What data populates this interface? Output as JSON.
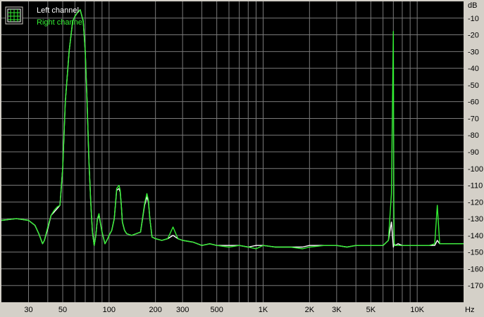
{
  "colors": {
    "frame": "#d4d0c8",
    "plot_bg": "#000000",
    "grid": "#7a7a7a",
    "left_channel": "#ffffff",
    "right_channel": "#33ee33"
  },
  "legend": {
    "icon": "grid-window-icon",
    "placement": "top-left",
    "items": [
      {
        "label": "Left channel",
        "color": "#ffffff"
      },
      {
        "label": "Right channel",
        "color": "#33ee33"
      }
    ]
  },
  "chart_data": {
    "type": "line",
    "title": "",
    "xlabel": "Hz",
    "ylabel": "dB",
    "xscale": "log",
    "xlim": [
      20,
      20000
    ],
    "ylim": [
      -180,
      0
    ],
    "grid": true,
    "yticks": [
      -10,
      -20,
      -30,
      -40,
      -50,
      -60,
      -70,
      -80,
      -90,
      -100,
      -110,
      -120,
      -130,
      -140,
      -150,
      -160,
      -170
    ],
    "xticks": [
      {
        "value": 30,
        "label": "30"
      },
      {
        "value": 50,
        "label": "50"
      },
      {
        "value": 100,
        "label": "100"
      },
      {
        "value": 200,
        "label": "200"
      },
      {
        "value": 300,
        "label": "300"
      },
      {
        "value": 500,
        "label": "500"
      },
      {
        "value": 1000,
        "label": "1K"
      },
      {
        "value": 2000,
        "label": "2K"
      },
      {
        "value": 3000,
        "label": "3K"
      },
      {
        "value": 5000,
        "label": "5K"
      },
      {
        "value": 10000,
        "label": "10K"
      }
    ],
    "series": [
      {
        "name": "Left channel",
        "color": "#ffffff",
        "x": [
          20,
          25,
          30,
          33,
          35,
          37,
          38,
          40,
          42,
          44,
          46,
          48,
          50,
          52,
          55,
          58,
          60,
          62,
          65,
          68,
          70,
          72,
          74,
          76,
          78,
          80,
          82,
          84,
          86,
          88,
          90,
          94,
          98,
          100,
          104,
          108,
          112,
          116,
          118,
          120,
          122,
          126,
          130,
          140,
          150,
          160,
          170,
          176,
          180,
          184,
          190,
          200,
          220,
          240,
          260,
          280,
          300,
          350,
          400,
          450,
          500,
          600,
          700,
          800,
          900,
          1000,
          1200,
          1500,
          1800,
          2000,
          2500,
          3000,
          3500,
          4000,
          5000,
          6000,
          6500,
          6800,
          7000,
          7050,
          7100,
          7200,
          7500,
          8000,
          9000,
          10000,
          12000,
          13000,
          13500,
          14000,
          14500,
          15000,
          17000,
          20000
        ],
        "values": [
          -131,
          -130,
          -131,
          -134,
          -139,
          -145,
          -143,
          -136,
          -128,
          -126,
          -124,
          -122,
          -100,
          -60,
          -30,
          -12,
          -9,
          -7,
          -5,
          -12,
          -30,
          -60,
          -95,
          -120,
          -138,
          -146,
          -140,
          -130,
          -128,
          -133,
          -138,
          -145,
          -142,
          -140,
          -137,
          -130,
          -113,
          -112,
          -114,
          -122,
          -132,
          -137,
          -139,
          -140,
          -139,
          -138,
          -122,
          -117,
          -120,
          -130,
          -141,
          -142,
          -143,
          -142,
          -140,
          -142,
          -143,
          -144,
          -146,
          -145,
          -146,
          -146,
          -146,
          -147,
          -146,
          -146,
          -147,
          -147,
          -147,
          -146,
          -146,
          -146,
          -147,
          -146,
          -146,
          -146,
          -143,
          -132,
          -147,
          -146,
          -145,
          -146,
          -145,
          -146,
          -146,
          -146,
          -146,
          -146,
          -143,
          -145,
          -145,
          -145,
          -145,
          -145
        ]
      },
      {
        "name": "Right channel",
        "color": "#33ee33",
        "x": [
          20,
          25,
          30,
          33,
          35,
          37,
          38,
          40,
          42,
          44,
          46,
          48,
          50,
          52,
          55,
          58,
          60,
          62,
          65,
          68,
          70,
          72,
          74,
          76,
          78,
          80,
          82,
          84,
          86,
          88,
          90,
          94,
          98,
          100,
          104,
          108,
          112,
          116,
          118,
          120,
          122,
          126,
          130,
          140,
          150,
          160,
          170,
          176,
          180,
          184,
          190,
          200,
          220,
          240,
          260,
          280,
          300,
          350,
          400,
          450,
          500,
          600,
          700,
          800,
          900,
          1000,
          1200,
          1500,
          1800,
          2000,
          2500,
          3000,
          3500,
          4000,
          5000,
          6000,
          6500,
          6800,
          7000,
          7050,
          7100,
          7200,
          7500,
          8000,
          9000,
          10000,
          12000,
          13000,
          13500,
          14000,
          14500,
          15000,
          17000,
          20000
        ],
        "values": [
          -131,
          -130,
          -131,
          -134,
          -139,
          -145,
          -143,
          -135,
          -128,
          -125,
          -123,
          -122,
          -100,
          -60,
          -30,
          -12,
          -9,
          -7,
          -5,
          -12,
          -30,
          -60,
          -95,
          -120,
          -138,
          -146,
          -140,
          -130,
          -127,
          -133,
          -138,
          -145,
          -142,
          -140,
          -137,
          -130,
          -112,
          -110,
          -113,
          -122,
          -132,
          -137,
          -139,
          -140,
          -139,
          -138,
          -121,
          -115,
          -119,
          -130,
          -141,
          -142,
          -143,
          -142,
          -135,
          -142,
          -143,
          -144,
          -146,
          -145,
          -146,
          -147,
          -146,
          -147,
          -148,
          -146,
          -147,
          -147,
          -148,
          -147,
          -146,
          -146,
          -147,
          -146,
          -146,
          -146,
          -143,
          -115,
          -18,
          -120,
          -146,
          -146,
          -146,
          -146,
          -146,
          -146,
          -146,
          -145,
          -122,
          -145,
          -145,
          -145,
          -145,
          -145
        ]
      }
    ]
  }
}
